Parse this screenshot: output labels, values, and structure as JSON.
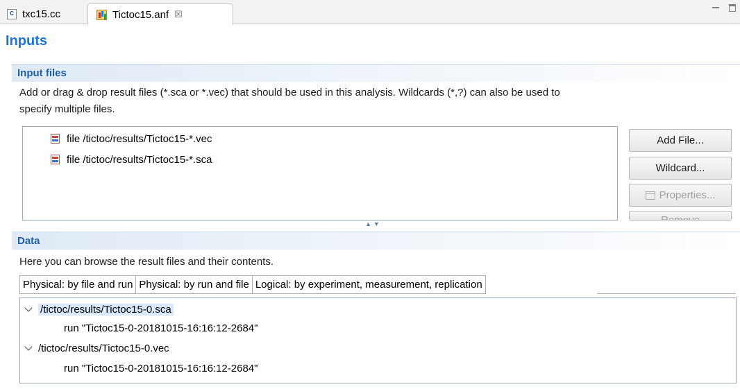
{
  "editor_tabs": [
    {
      "label": "txc15.cc",
      "icon": "cpp-file-icon"
    },
    {
      "label": "Tictoc15.anf",
      "icon": "analysis-file-icon",
      "close": "☒"
    }
  ],
  "form_title": "Inputs",
  "input_files": {
    "title": "Input files",
    "description_line1": "Add or drag & drop result files (*.sca or *.vec) that should be used in this analysis. Wildcards (*,?) can also be used to",
    "description_line2": "specify multiple files.",
    "files": [
      "file /tictoc/results/Tictoc15-*.vec",
      "file /tictoc/results/Tictoc15-*.sca"
    ],
    "buttons": {
      "add_file": "Add File...",
      "wildcard": "Wildcard...",
      "properties": "Properties...",
      "remove": "Remove"
    }
  },
  "data": {
    "title": "Data",
    "description": "Here you can browse the result files and their contents.",
    "tabs": [
      "Physical: by file and run",
      "Physical: by run and file",
      "Logical: by experiment, measurement, replication"
    ],
    "tree": [
      {
        "file": "/tictoc/results/Tictoc15-0.sca",
        "run": "run \"Tictoc15-0-20181015-16:16:12-2684\""
      },
      {
        "file": "/tictoc/results/Tictoc15-0.vec",
        "run": "run \"Tictoc15-0-20181015-16:16:12-2684\""
      }
    ]
  },
  "colors": {
    "title_blue": "#1e73d8",
    "section_header_blue": "#1e5ea8",
    "selection": "#d9e8fb"
  }
}
